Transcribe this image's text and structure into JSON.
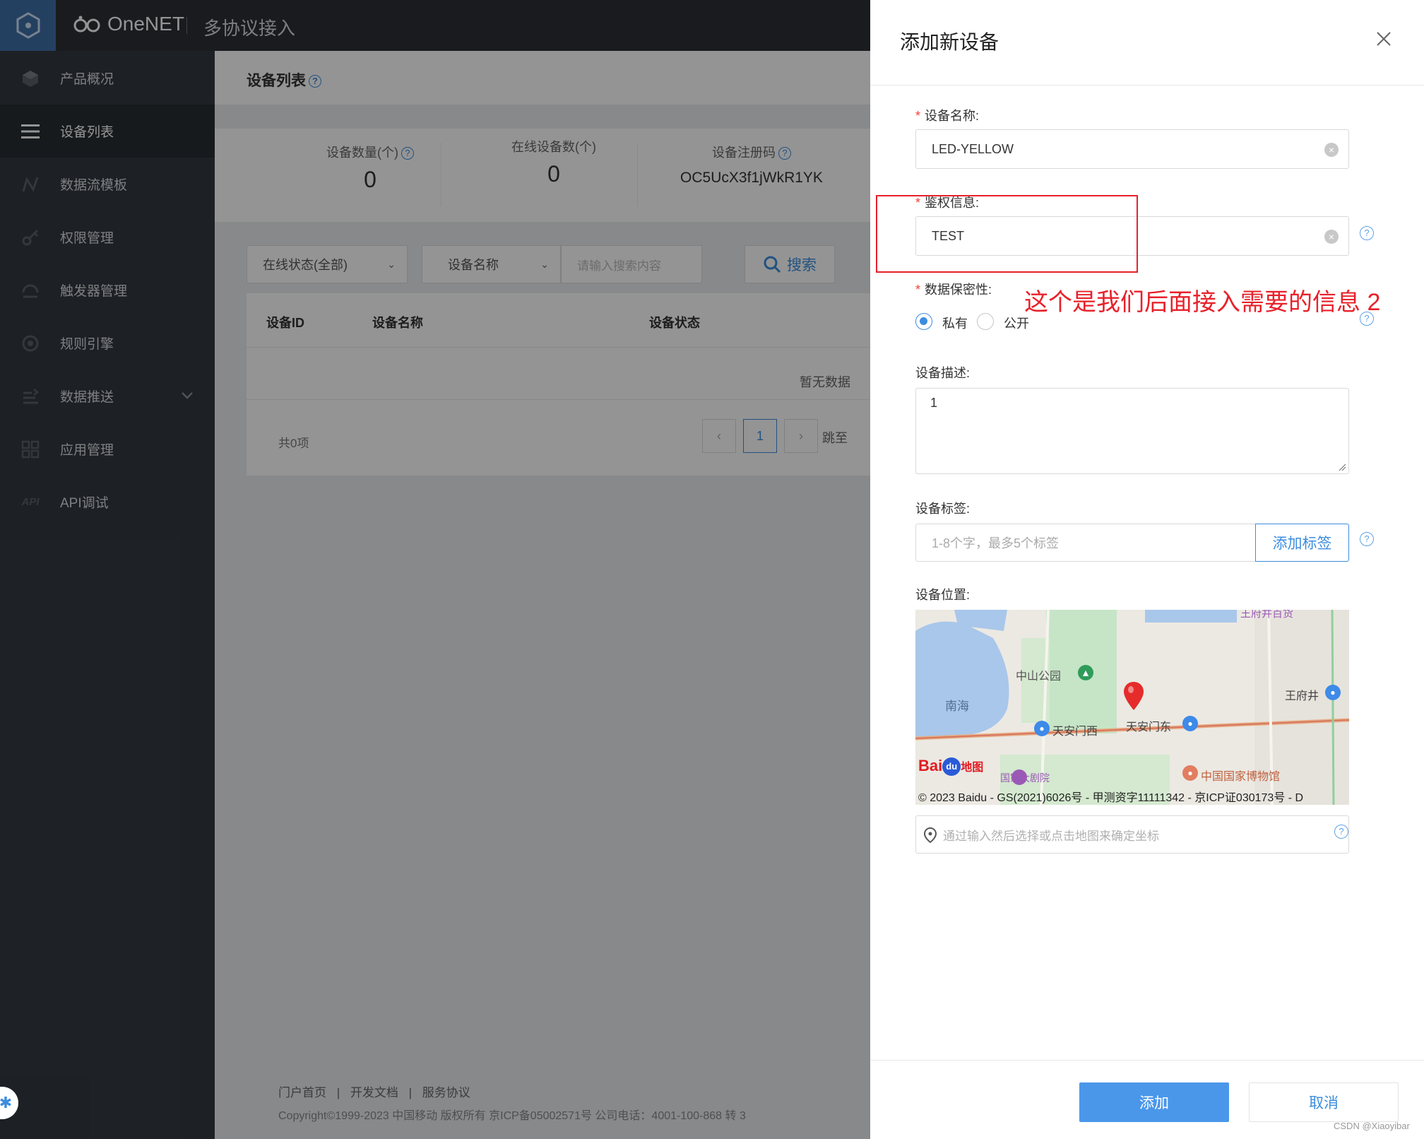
{
  "topbar": {
    "brand": "OneNET",
    "subtitle": "多协议接入"
  },
  "sidebar": {
    "items": [
      {
        "label": "产品概况",
        "icon": "cube-icon"
      },
      {
        "label": "设备列表",
        "icon": "list-icon"
      },
      {
        "label": "数据流模板",
        "icon": "datastream-icon"
      },
      {
        "label": "权限管理",
        "icon": "key-icon"
      },
      {
        "label": "触发器管理",
        "icon": "trigger-icon"
      },
      {
        "label": "规则引擎",
        "icon": "rule-icon"
      },
      {
        "label": "数据推送",
        "icon": "push-icon"
      },
      {
        "label": "应用管理",
        "icon": "apps-icon"
      },
      {
        "label": "API调试",
        "icon": "api-icon"
      }
    ],
    "active": "设备列表"
  },
  "page": {
    "title": "设备列表",
    "stats": {
      "device_count_label": "设备数量(个)",
      "device_count": "0",
      "online_count_label": "在线设备数(个)",
      "online_count": "0",
      "reg_code_label": "设备注册码",
      "reg_code": "OC5UcX3f1jWkR1YK"
    },
    "filters": {
      "status": "在线状态(全部)",
      "field": "设备名称",
      "search_placeholder": "请输入搜索内容",
      "search_button": "搜索"
    },
    "table": {
      "headers": [
        "设备ID",
        "设备名称",
        "设备状态"
      ],
      "empty": "暂无数据",
      "total": "共0项",
      "page": "1",
      "jump": "跳至"
    },
    "footer": {
      "links": [
        "门户首页",
        "|",
        "开发文档",
        "|",
        "服务协议"
      ],
      "copyright": "Copyright©1999-2023 中国移动 版权所有 京ICP备05002571号 公司电话：4001-100-868 转 3"
    }
  },
  "drawer": {
    "title": "添加新设备",
    "name_label": "设备名称:",
    "name_value": "LED-YELLOW",
    "auth_label": "鉴权信息:",
    "auth_value": "TEST",
    "privacy_label": "数据保密性:",
    "privacy_private": "私有",
    "privacy_public": "公开",
    "desc_label": "设备描述:",
    "desc_value": "1",
    "tags_label": "设备标签:",
    "tags_placeholder": "1-8个字，最多5个标签",
    "tags_button": "添加标签",
    "location_label": "设备位置:",
    "location_placeholder": "通过输入然后选择或点击地图来确定坐标",
    "add_button": "添加",
    "cancel_button": "取消"
  },
  "map": {
    "labels": {
      "zhongshan_park": "中山公园",
      "nanhai": "南海",
      "tiananmen_west": "天安门西",
      "tiananmen_east": "天安门东",
      "wangfujing": "王府井",
      "wangfujing_store": "王府井百货",
      "national_museum": "中国国家博物馆",
      "theater": "国家大剧院"
    },
    "copyright": "© 2023 Baidu - GS(2021)6026号 - 甲测资字11111342 - 京ICP证030173号 - D",
    "logo_text": "Bai",
    "logo_text2": "地图"
  },
  "annotation": "这个是我们后面接入需要的信息 2",
  "watermark": "CSDN @Xiaoyibar"
}
